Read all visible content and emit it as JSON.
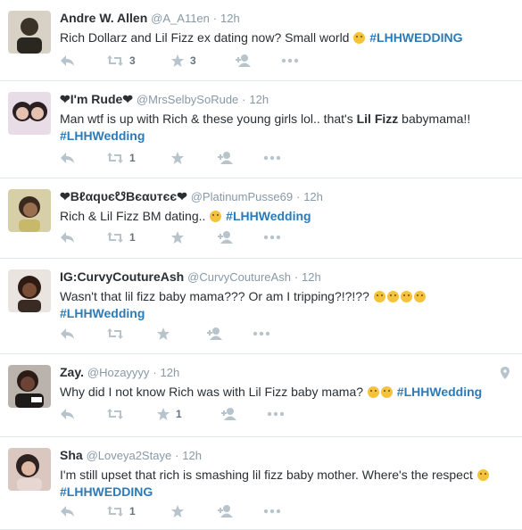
{
  "tweets": [
    {
      "name": "Andre W. Allen",
      "handle": "@A_A11en",
      "time": "12h",
      "text": [
        "Rich Dollarz and Lil Fizz ex dating now? Small world",
        "#LHHWEDDING"
      ],
      "retweets": "3",
      "favorites": "3",
      "avatar_color": "#3a3326"
    },
    {
      "name": "❤I'm Rude❤",
      "handle": "@MrsSelbySoRude",
      "time": "12h",
      "text": [
        "Man wtf is up with Rich & these young girls lol.. that's",
        "Lil Fizz",
        "babymama!!",
        "#LHHWedding"
      ],
      "retweets": "1",
      "favorites": "",
      "avatar_color": "#c8a8b4"
    },
    {
      "name": "❤Bℓαqυє☋Bєαυтєє❤",
      "handle": "@PlatinumPusse69",
      "time": "12h",
      "text": [
        "Rich & Lil Fizz BM dating..",
        "#LHHWedding"
      ],
      "retweets": "1",
      "favorites": "",
      "avatar_color": "#8a6a4a"
    },
    {
      "name": "IG:CurvyCoutureAsh",
      "handle": "@CurvyCoutureAsh",
      "time": "12h",
      "text": [
        "Wasn't that lil fizz baby mama??? Or am I tripping?!?!??",
        "#LHHWedding"
      ],
      "retweets": "",
      "favorites": "",
      "avatar_color": "#5a3a2a"
    },
    {
      "name": "Zay.",
      "handle": "@Hozayyyy",
      "time": "12h",
      "text": [
        "Why did I not know Rich was with Lil Fizz baby mama?",
        "#LHHWedding"
      ],
      "retweets": "",
      "favorites": "1",
      "avatar_color": "#4a3530"
    },
    {
      "name": "Sha",
      "handle": "@Loveya2Staye",
      "time": "12h",
      "text": [
        "I'm still upset that rich is smashing lil fizz baby mother. Where's the respect",
        "#LHHWEDDING"
      ],
      "retweets": "1",
      "favorites": "",
      "avatar_color": "#c9a89a"
    }
  ],
  "icons": {
    "reply": "reply-icon",
    "retweet": "retweet-icon",
    "favorite": "star-icon",
    "follow": "follow-icon",
    "more": "more-icon",
    "geo": "location-icon"
  },
  "colors": {
    "hashtag": "#2b7bb9",
    "icon": "#8899a6",
    "divider": "#e1e8ed"
  }
}
